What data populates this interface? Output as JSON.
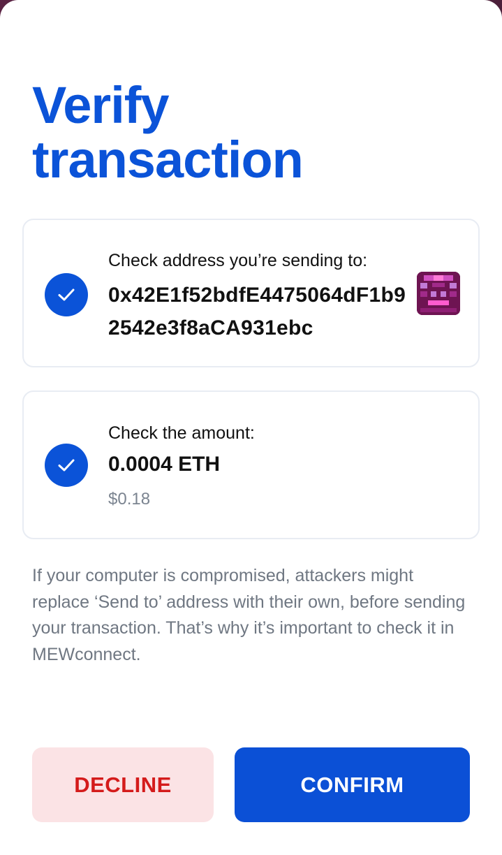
{
  "title": "Verify transaction",
  "address_card": {
    "label": "Check address you’re sending to:",
    "address": "0x42E1f52bdfE4475064dF1b92542e3f8aCA931ebc",
    "identicon": "address-identicon"
  },
  "amount_card": {
    "label": "Check the amount:",
    "amount": "0.0004 ETH",
    "fiat": "$0.18"
  },
  "warning": "If your computer is compromised, attackers might replace ‘Send to’ address with their own, before sending your transaction. That’s why it’s important to check it in MEWconnect.",
  "actions": {
    "decline_label": "DECLINE",
    "confirm_label": "CONFIRM"
  },
  "colors": {
    "accent": "#0b53d8",
    "decline_bg": "#fbe3e5",
    "decline_text": "#d41b1b",
    "confirm_bg": "#0b50d6",
    "secondary_text": "#6f7782"
  },
  "icons": {
    "check": "checkmark-icon"
  }
}
